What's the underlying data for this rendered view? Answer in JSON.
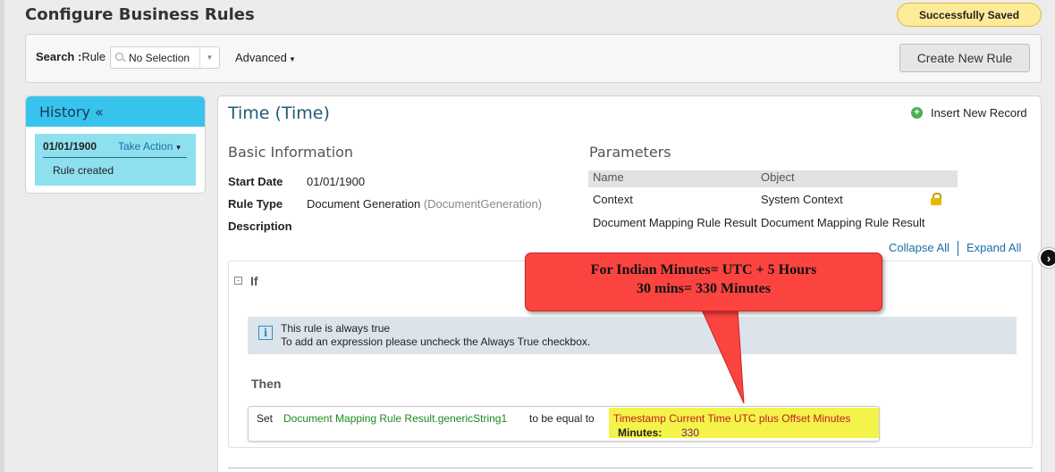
{
  "page": {
    "title": "Configure Business Rules",
    "status_badge": "Successfully Saved"
  },
  "search": {
    "label_bold": "Search :",
    "label_field": "Rule",
    "selected": "No Selection",
    "advanced_label": "Advanced",
    "create_button": "Create New Rule"
  },
  "history": {
    "title": "History «",
    "entries": [
      {
        "date": "01/01/1900",
        "action": "Take Action",
        "text": "Rule created"
      }
    ]
  },
  "rule": {
    "title": "Time (Time)",
    "insert_record": "Insert New Record",
    "basic_heading": "Basic Information",
    "start_date_label": "Start Date",
    "start_date": "01/01/1900",
    "rule_type_label": "Rule Type",
    "rule_type": "Document Generation",
    "rule_type_code": "(DocumentGeneration)",
    "description_label": "Description"
  },
  "parameters": {
    "heading": "Parameters",
    "columns": [
      "Name",
      "Object"
    ],
    "rows": [
      {
        "name": "Context",
        "object": "System Context",
        "locked": true
      },
      {
        "name": "Document Mapping Rule Result",
        "object": "Document Mapping Rule Result",
        "locked": false
      }
    ]
  },
  "links": {
    "collapse_all": "Collapse All",
    "expand_all": "Expand All"
  },
  "if_block": {
    "label": "If",
    "info_line1": "This rule is always true",
    "info_line2": "To add an expression please uncheck the Always True checkbox.",
    "then_label": "Then",
    "set_word": "Set",
    "target": "Document Mapping Rule Result.genericString1",
    "equal_text": "to be equal to",
    "function": "Timestamp Current Time UTC plus Offset Minutes",
    "minutes_label": "Minutes:",
    "minutes_value": "330"
  },
  "callout": {
    "line1": "For Indian Minutes= UTC + 5 Hours",
    "line2": "30 mins= 330 Minutes"
  },
  "colors": {
    "history_header": "#38c3ec",
    "history_entry": "#8ee0ef",
    "callout": "#fb4440",
    "highlight": "#f3f34a",
    "link": "#1a6fa8"
  }
}
